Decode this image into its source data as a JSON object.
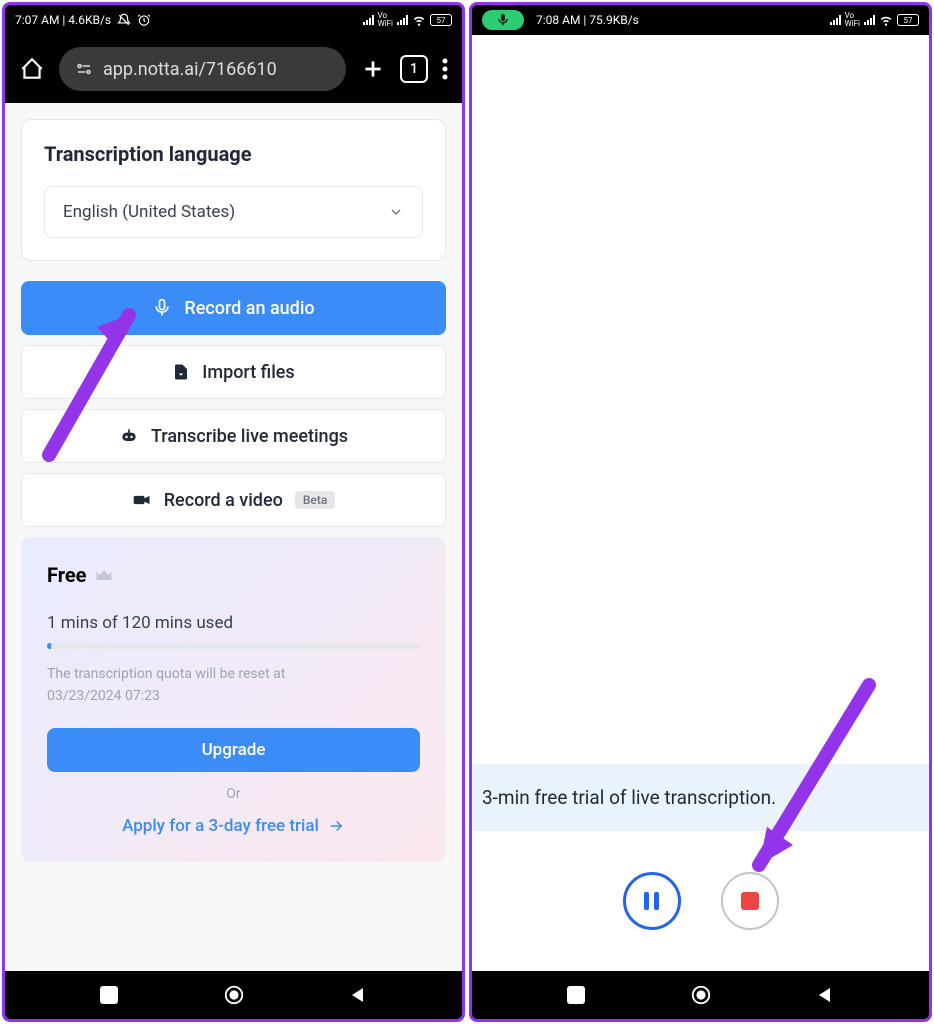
{
  "left": {
    "status": {
      "time_info": "7:07 AM | 4.6KB/s",
      "battery": "57"
    },
    "browser": {
      "url": "app.notta.ai/7166610",
      "tab_count": "1"
    },
    "card": {
      "title": "Transcription language",
      "dropdown_value": "English (United States)"
    },
    "actions": {
      "record_audio": "Record an audio",
      "import_files": "Import files",
      "transcribe_meetings": "Transcribe live meetings",
      "record_video": "Record a video",
      "beta": "Beta"
    },
    "plan": {
      "title": "Free",
      "usage": "1 mins of 120 mins used",
      "note_line1": "The transcription quota will be reset at",
      "note_line2": "03/23/2024 07:23",
      "upgrade": "Upgrade",
      "or": "Or",
      "trial_link": "Apply for a 3-day free trial"
    }
  },
  "right": {
    "status": {
      "time_info": "7:08 AM | 75.9KB/s",
      "battery": "57"
    },
    "trial_banner": "3-min free trial of live transcription."
  }
}
